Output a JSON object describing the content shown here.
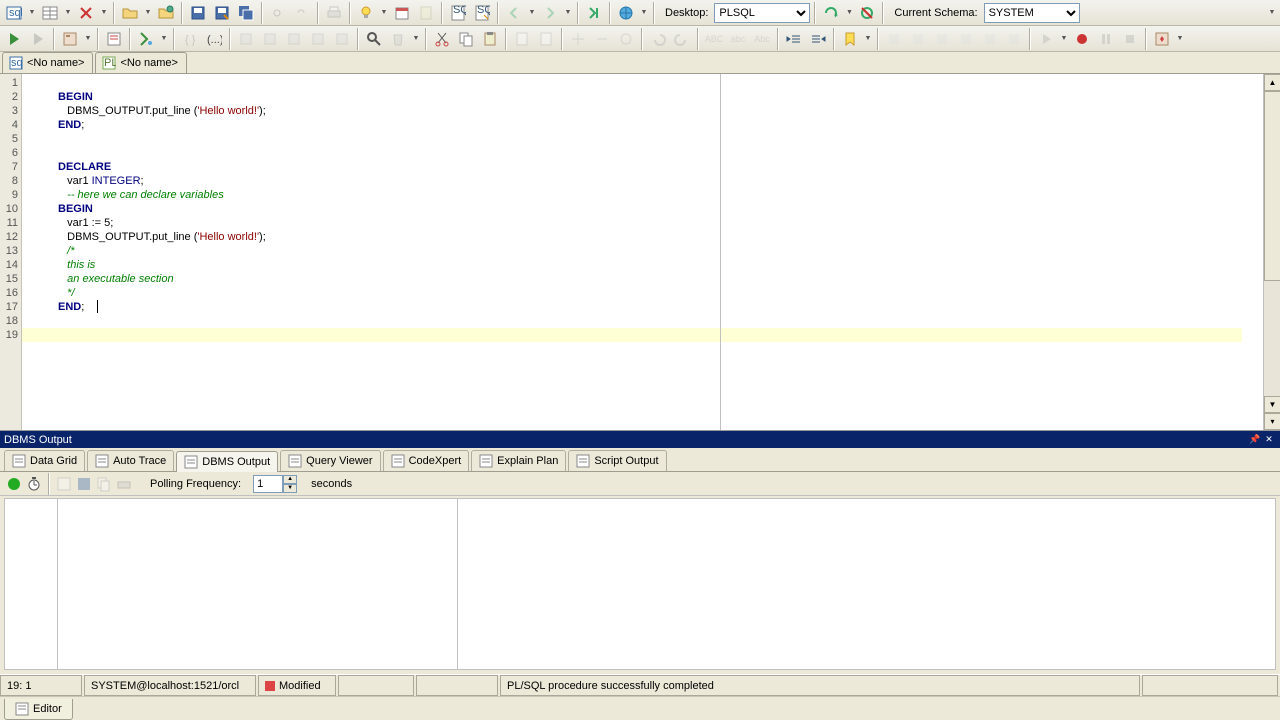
{
  "toolbar1": {
    "desktop_label": "Desktop:",
    "desktop_value": "PLSQL",
    "schema_label": "Current Schema:",
    "schema_value": "SYSTEM"
  },
  "editor_tabs": [
    {
      "label": "<No name>"
    },
    {
      "label": "<No name>"
    }
  ],
  "code_lines": [
    {
      "n": 1,
      "tokens": []
    },
    {
      "n": 2,
      "tokens": [
        {
          "t": "BEGIN",
          "c": "kw"
        }
      ]
    },
    {
      "n": 3,
      "tokens": [
        {
          "t": "   DBMS_OUTPUT.put_line ("
        },
        {
          "t": "'Hello world!'",
          "c": "str"
        },
        {
          "t": ");"
        }
      ]
    },
    {
      "n": 4,
      "tokens": [
        {
          "t": "END",
          "c": "kw"
        },
        {
          "t": ";"
        }
      ]
    },
    {
      "n": 5,
      "tokens": []
    },
    {
      "n": 6,
      "tokens": []
    },
    {
      "n": 7,
      "tokens": [
        {
          "t": "DECLARE",
          "c": "kw"
        }
      ]
    },
    {
      "n": 8,
      "tokens": [
        {
          "t": "   var1 "
        },
        {
          "t": "INTEGER",
          "c": "dt"
        },
        {
          "t": ";"
        }
      ]
    },
    {
      "n": 9,
      "tokens": [
        {
          "t": "   -- here we can declare variables",
          "c": "cmt"
        }
      ]
    },
    {
      "n": 10,
      "tokens": [
        {
          "t": "BEGIN",
          "c": "kw"
        }
      ]
    },
    {
      "n": 11,
      "tokens": [
        {
          "t": "   var1 := 5;"
        }
      ]
    },
    {
      "n": 12,
      "tokens": [
        {
          "t": "   DBMS_OUTPUT.put_line ("
        },
        {
          "t": "'Hello world!'",
          "c": "str"
        },
        {
          "t": ");"
        }
      ]
    },
    {
      "n": 13,
      "tokens": [
        {
          "t": "   /*",
          "c": "cmt"
        }
      ]
    },
    {
      "n": 14,
      "tokens": [
        {
          "t": "   this is",
          "c": "cmt"
        }
      ]
    },
    {
      "n": 15,
      "tokens": [
        {
          "t": "   an executable section",
          "c": "cmt"
        }
      ]
    },
    {
      "n": 16,
      "tokens": [
        {
          "t": "   */",
          "c": "cmt"
        }
      ]
    },
    {
      "n": 17,
      "tokens": [
        {
          "t": "END",
          "c": "kw"
        },
        {
          "t": ";"
        }
      ],
      "cursor_after": true
    },
    {
      "n": 18,
      "tokens": []
    },
    {
      "n": 19,
      "tokens": [],
      "highlight": true
    }
  ],
  "output_panel": {
    "title": "DBMS Output",
    "tabs": [
      {
        "label": "Data Grid"
      },
      {
        "label": "Auto Trace"
      },
      {
        "label": "DBMS Output",
        "active": true
      },
      {
        "label": "Query Viewer"
      },
      {
        "label": "CodeXpert"
      },
      {
        "label": "Explain Plan"
      },
      {
        "label": "Script Output"
      }
    ],
    "polling_label": "Polling Frequency:",
    "polling_value": "1",
    "polling_unit": "seconds"
  },
  "status": {
    "pos": "19: 1",
    "conn": "SYSTEM@localhost:1521/orcl",
    "modified": "Modified",
    "msg": "PL/SQL procedure successfully completed"
  },
  "bottom_tab": "Editor"
}
